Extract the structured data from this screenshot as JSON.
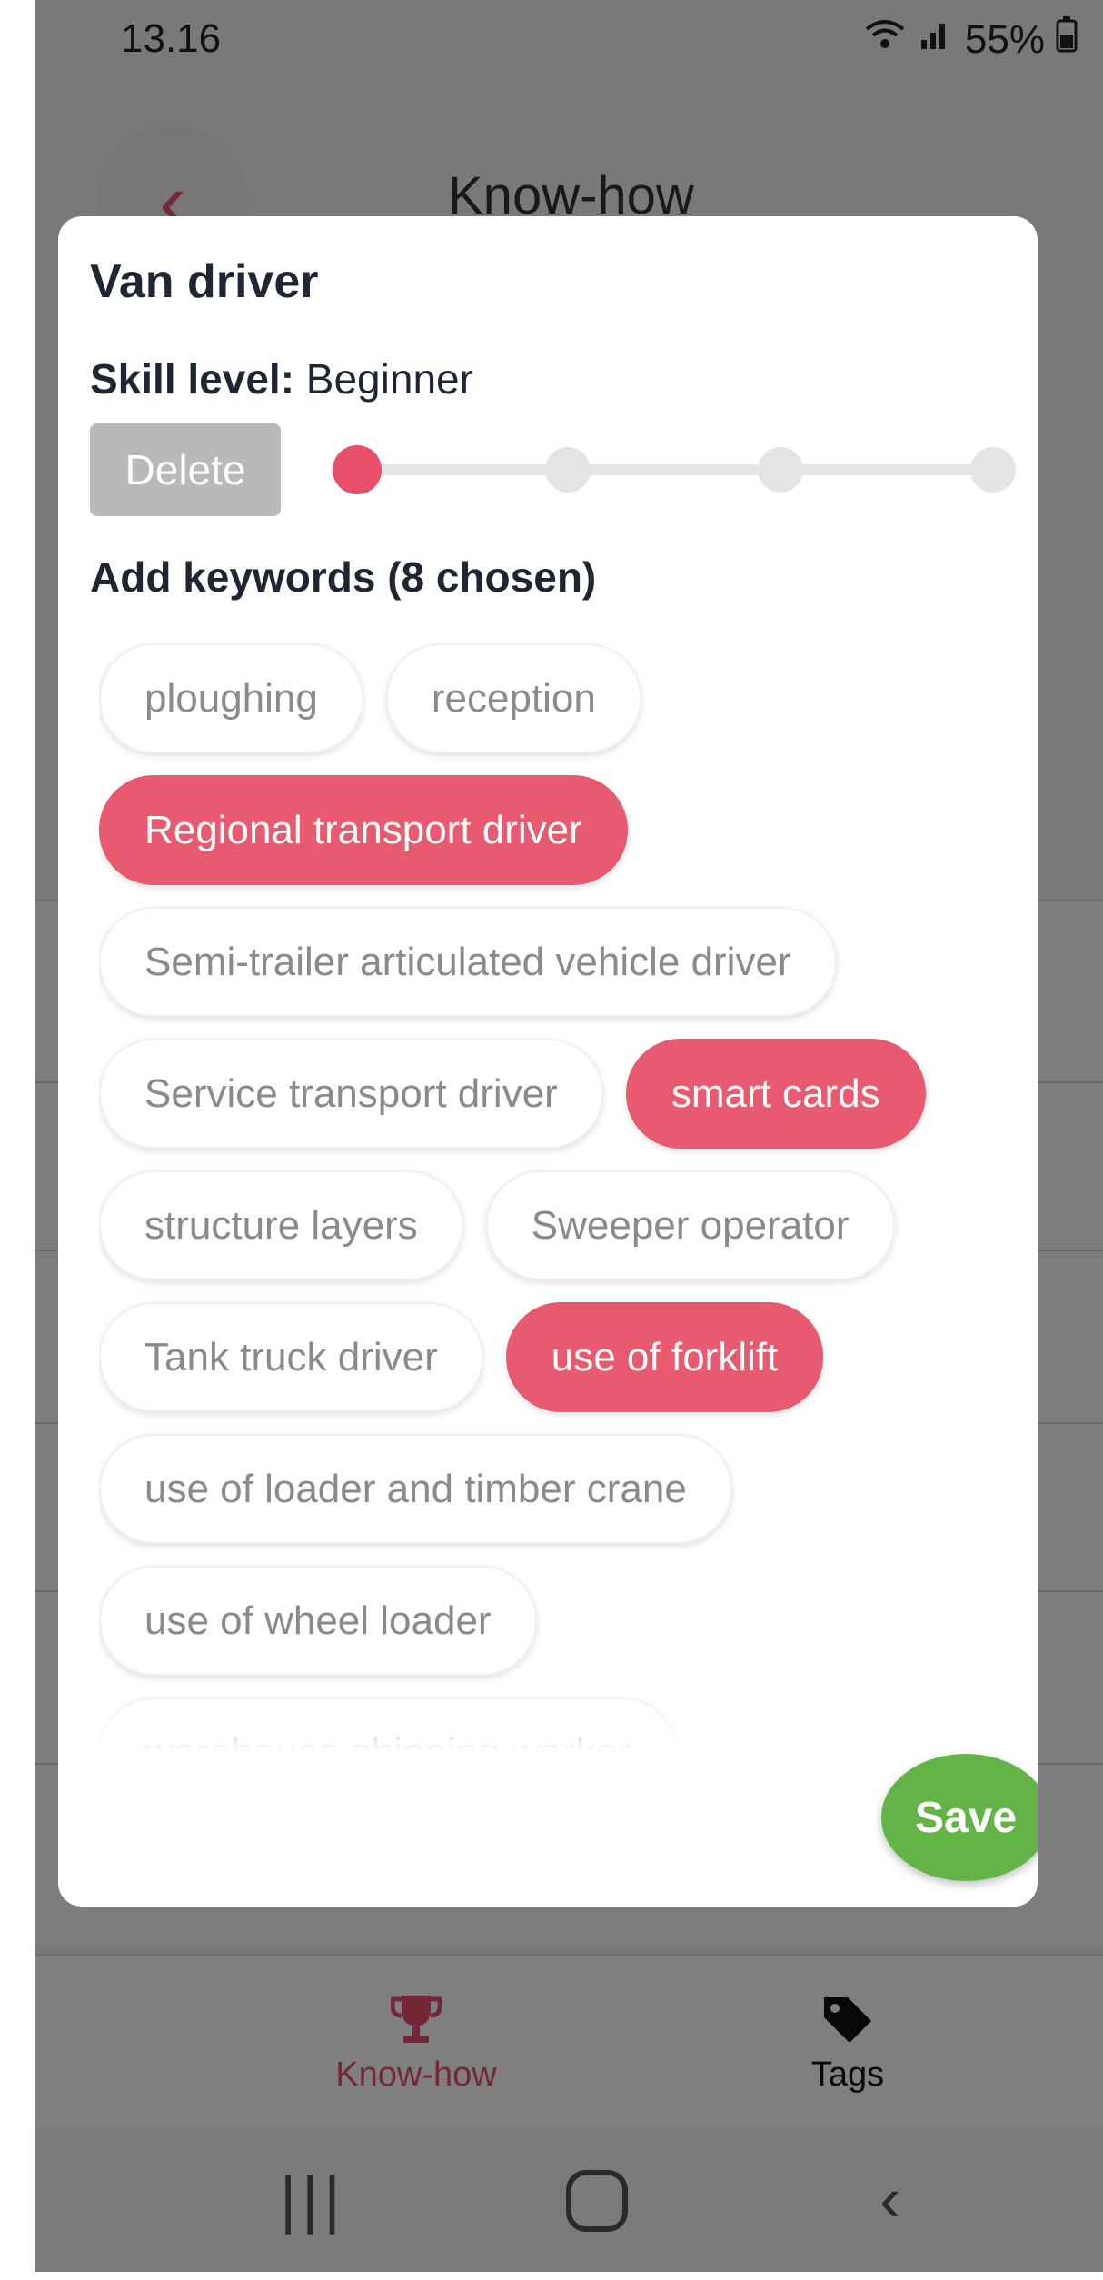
{
  "status_bar": {
    "time": "13.16",
    "signal": "••• .∥",
    "battery": "55%"
  },
  "header": {
    "title": "Know-how",
    "back_icon": "‹"
  },
  "dialog": {
    "title": "Van driver",
    "skill_label": "Skill level:",
    "skill_value": "Beginner",
    "skill_level_index": 1,
    "skill_level_count": 4,
    "delete_label": "Delete",
    "keywords_heading": "Add keywords (8 chosen)",
    "keywords": [
      [
        {
          "label": "ploughing",
          "selected": false
        },
        {
          "label": "reception",
          "selected": false
        }
      ],
      [
        {
          "label": "Regional transport driver",
          "selected": true
        }
      ],
      [
        {
          "label": "Semi-trailer articulated vehicle driver",
          "selected": false
        }
      ],
      [
        {
          "label": "Service transport driver",
          "selected": false
        },
        {
          "label": "smart cards",
          "selected": true
        }
      ],
      [
        {
          "label": "structure layers",
          "selected": false
        },
        {
          "label": "Sweeper operator",
          "selected": false
        }
      ],
      [
        {
          "label": "Tank truck driver",
          "selected": false
        },
        {
          "label": "use of forklift",
          "selected": true
        }
      ],
      [
        {
          "label": "use of loader and timber crane",
          "selected": false
        }
      ],
      [
        {
          "label": "use of wheel loader",
          "selected": false
        }
      ],
      [
        {
          "label": "warehouse shipping worker",
          "selected": false
        }
      ]
    ],
    "save_label": "Save"
  },
  "bottom_nav": {
    "knowhow_label": "Know-how",
    "tags_label": "Tags",
    "active": "knowhow"
  },
  "system_nav": {
    "recent": "|||",
    "back": "‹"
  },
  "colors": {
    "accent": "#e8506a",
    "save": "#63b346",
    "chip_text": "#8a8a8a"
  }
}
